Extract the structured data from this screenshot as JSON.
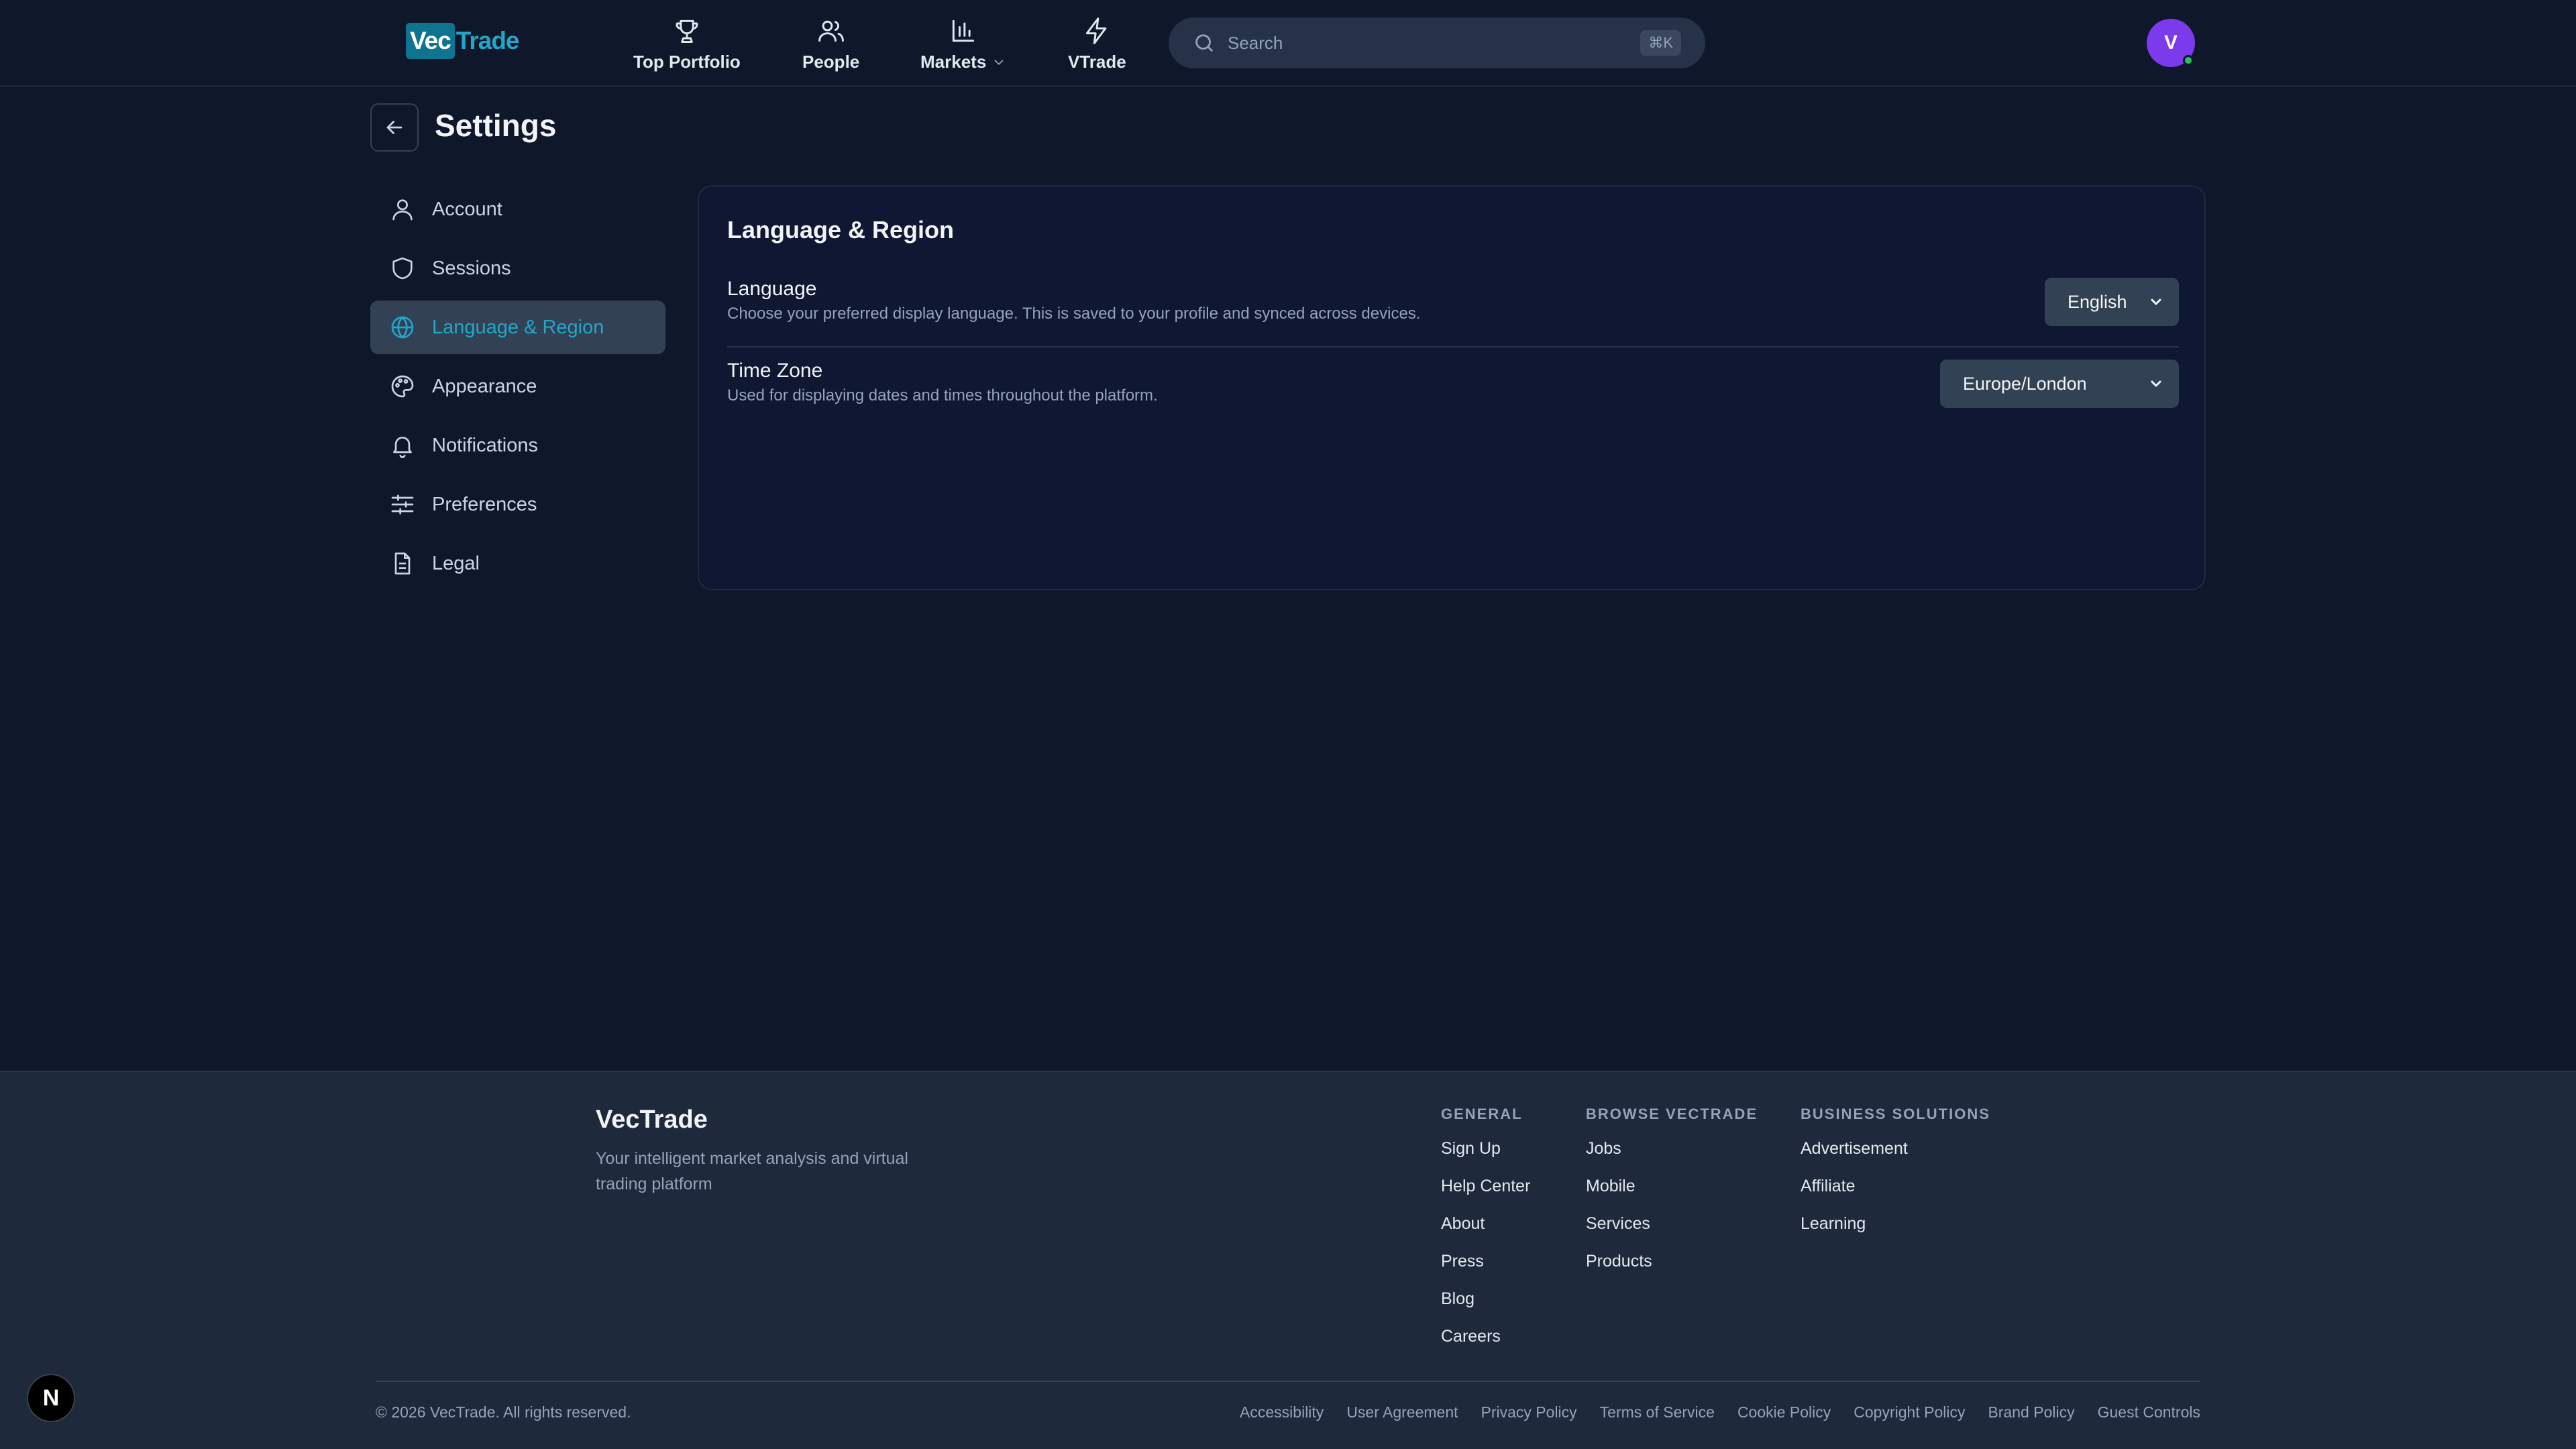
{
  "header": {
    "logo": {
      "part1": "Vec",
      "part2": "Trade"
    },
    "nav": [
      {
        "label": "Top Portfolio",
        "icon": "trophy-icon"
      },
      {
        "label": "People",
        "icon": "users-icon"
      },
      {
        "label": "Markets",
        "icon": "bar-chart-icon",
        "has_dropdown": true
      },
      {
        "label": "VTrade",
        "icon": "lightning-icon"
      }
    ],
    "search": {
      "placeholder": "Search",
      "shortcut": "⌘K"
    },
    "avatar_initial": "V"
  },
  "page": {
    "title": "Settings"
  },
  "sidebar": {
    "items": [
      {
        "label": "Account",
        "icon": "user-icon"
      },
      {
        "label": "Sessions",
        "icon": "shield-icon"
      },
      {
        "label": "Language & Region",
        "icon": "globe-icon",
        "active": true
      },
      {
        "label": "Appearance",
        "icon": "palette-icon"
      },
      {
        "label": "Notifications",
        "icon": "bell-icon"
      },
      {
        "label": "Preferences",
        "icon": "sliders-icon"
      },
      {
        "label": "Legal",
        "icon": "document-icon"
      }
    ]
  },
  "panel": {
    "title": "Language & Region",
    "language": {
      "label": "Language",
      "description": "Choose your preferred display language. This is saved to your profile and synced across devices.",
      "value": "English"
    },
    "timezone": {
      "label": "Time Zone",
      "description": "Used for displaying dates and times throughout the platform.",
      "value": "Europe/London"
    }
  },
  "footer": {
    "brand": "VecTrade",
    "tagline": "Your intelligent market analysis and virtual trading platform",
    "columns": [
      {
        "heading": "GENERAL",
        "links": [
          "Sign Up",
          "Help Center",
          "About",
          "Press",
          "Blog",
          "Careers"
        ]
      },
      {
        "heading": "BROWSE VECTRADE",
        "links": [
          "Jobs",
          "Mobile",
          "Services",
          "Products"
        ]
      },
      {
        "heading": "BUSINESS SOLUTIONS",
        "links": [
          "Advertisement",
          "Affiliate",
          "Learning"
        ]
      }
    ],
    "copyright": "© 2026 VecTrade. All rights reserved.",
    "legal_links": [
      "Accessibility",
      "User Agreement",
      "Privacy Policy",
      "Terms of Service",
      "Cookie Policy",
      "Copyright Policy",
      "Brand Policy",
      "Guest Controls"
    ]
  },
  "dev_badge": "N",
  "colors": {
    "background": "#0f172a",
    "accent": "#22a6c9",
    "avatar": "#7c3aed",
    "online": "#22c55e"
  }
}
